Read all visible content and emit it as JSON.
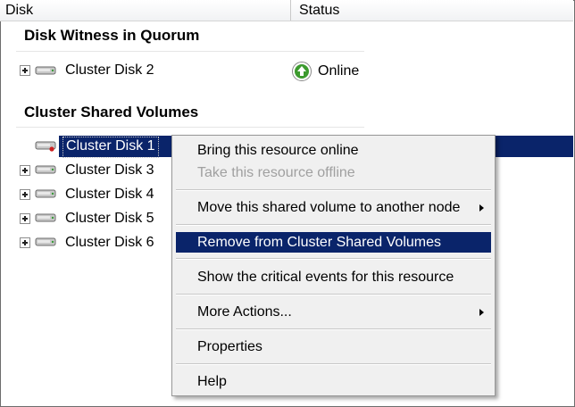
{
  "header": {
    "disk_col": "Disk",
    "status_col": "Status"
  },
  "groups": {
    "witness": "Disk Witness in Quorum",
    "csv": "Cluster Shared Volumes"
  },
  "witness_disk": {
    "label": "Cluster Disk 2",
    "status": "Online",
    "status_icon": "online-arrow-icon"
  },
  "csv_disks": [
    {
      "label": "Cluster Disk 1",
      "selected": true
    },
    {
      "label": "Cluster Disk 3"
    },
    {
      "label": "Cluster Disk 4"
    },
    {
      "label": "Cluster Disk 5"
    },
    {
      "label": "Cluster Disk 6"
    }
  ],
  "context_menu": {
    "items": [
      {
        "label": "Bring this resource online"
      },
      {
        "label": "Take this resource offline",
        "disabled": true
      },
      {
        "label": "Move this shared volume to another node",
        "submenu": true
      },
      {
        "label": "Remove from Cluster Shared Volumes",
        "highlighted": true
      },
      {
        "label": "Show the critical events for this resource"
      },
      {
        "label": "More Actions...",
        "submenu": true
      },
      {
        "label": "Properties"
      },
      {
        "label": "Help"
      }
    ]
  },
  "colors": {
    "selection": "#0a246a",
    "menu_bg": "#f0f0f0",
    "online_green": "#3c9a2e"
  }
}
